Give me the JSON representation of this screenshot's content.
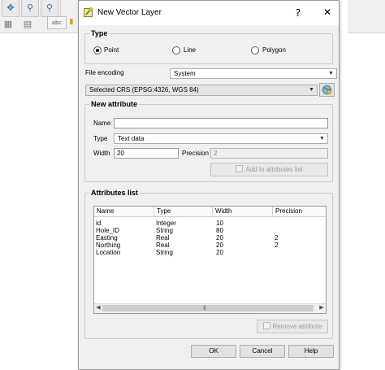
{
  "dialog": {
    "title": "New Vector Layer",
    "help_glyph": "?",
    "close_glyph": "✕"
  },
  "type_group": {
    "title": "Type",
    "options": [
      {
        "label": "Point",
        "selected": true
      },
      {
        "label": "Line",
        "selected": false
      },
      {
        "label": "Polygon",
        "selected": false
      }
    ]
  },
  "file_encoding": {
    "label": "File encoding",
    "value": "System"
  },
  "crs": {
    "value": "Selected CRS (EPSG:4326, WGS 84)"
  },
  "new_attribute": {
    "title": "New attribute",
    "name_label": "Name",
    "name_value": "",
    "type_label": "Type",
    "type_value": "Text data",
    "width_label": "Width",
    "width_value": "20",
    "precision_label": "Precision",
    "precision_value": "2",
    "add_button": "Add to attributes list"
  },
  "attributes_list": {
    "title": "Attributes list",
    "columns": [
      "Name",
      "Type",
      "Width",
      "Precision"
    ],
    "rows": [
      [
        "id",
        "Integer",
        "10",
        ""
      ],
      [
        "Hole_ID",
        "String",
        "80",
        ""
      ],
      [
        "Easting",
        "Real",
        "20",
        "2"
      ],
      [
        "Northing",
        "Real",
        "20",
        "2"
      ],
      [
        "Location",
        "String",
        "20",
        ""
      ]
    ],
    "remove_button": "Remove attribute"
  },
  "buttons": {
    "ok": "OK",
    "cancel": "Cancel",
    "help": "Help"
  },
  "background_toolbar": {
    "label_tool": "abc"
  }
}
